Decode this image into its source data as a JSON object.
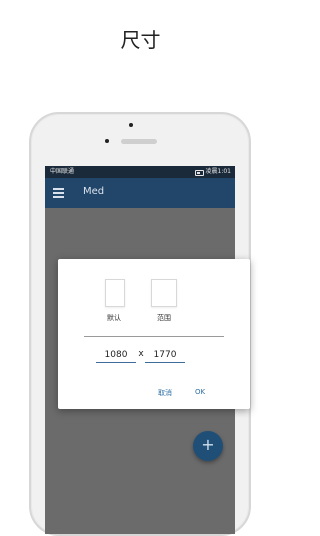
{
  "page": {
    "heading": "尺寸"
  },
  "statusbar": {
    "carrier": "中国联通",
    "time": "凌晨1:01"
  },
  "appbar": {
    "title": "Med"
  },
  "dialog": {
    "options": [
      {
        "label": "默认"
      },
      {
        "label": "范围"
      }
    ],
    "width_value": "1080",
    "separator": "x",
    "height_value": "1770",
    "cancel_label": "取消",
    "ok_label": "OK"
  },
  "fab": {
    "icon": "plus-icon",
    "glyph": "+"
  },
  "colors": {
    "appbar": "#22456a",
    "statusbar": "#1b2a3a",
    "screen_scrim": "#6b6b6b",
    "accent": "#2c6fa5",
    "fab": "#1f4f76"
  }
}
